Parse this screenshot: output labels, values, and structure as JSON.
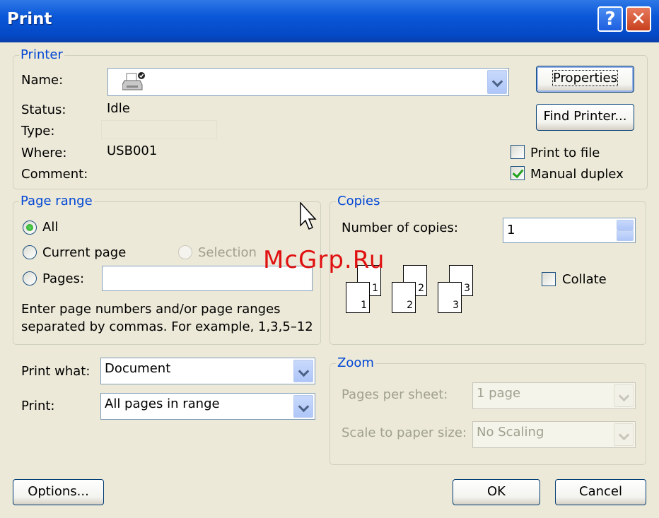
{
  "window": {
    "title": "Print",
    "help_label": "?",
    "close_label": "✕"
  },
  "printer": {
    "legend": "Printer",
    "name_label": "Name:",
    "name_value": "",
    "status_label": "Status:",
    "status_value": "Idle",
    "type_label": "Type:",
    "type_value": "",
    "where_label": "Where:",
    "where_value": "USB001",
    "comment_label": "Comment:",
    "comment_value": "",
    "properties_label": "Properties",
    "find_printer_label": "Find Printer...",
    "print_to_file_label": "Print to file",
    "print_to_file_checked": false,
    "manual_duplex_label": "Manual duplex",
    "manual_duplex_checked": true
  },
  "page_range": {
    "legend": "Page range",
    "all_label": "All",
    "current_page_label": "Current page",
    "selection_label": "Selection",
    "pages_label": "Pages:",
    "pages_value": "",
    "hint_line1": "Enter page numbers and/or page ranges",
    "hint_line2": "separated by commas.  For example, 1,3,5–12",
    "selected": "all"
  },
  "copies": {
    "legend": "Copies",
    "number_label": "Number of copies:",
    "number_value": "1",
    "collate_label": "Collate",
    "collate_checked": false,
    "page_numbers": [
      "1",
      "1",
      "2",
      "2",
      "3",
      "3"
    ]
  },
  "print_what": {
    "label": "Print what:",
    "value": "Document"
  },
  "print": {
    "label": "Print:",
    "value": "All pages in range"
  },
  "zoom": {
    "legend": "Zoom",
    "pages_per_sheet_label": "Pages per sheet:",
    "pages_per_sheet_value": "1 page",
    "scale_label": "Scale to paper size:",
    "scale_value": "No Scaling"
  },
  "buttons": {
    "options": "Options...",
    "ok": "OK",
    "cancel": "Cancel"
  },
  "watermark": "McGrp.Ru",
  "colors": {
    "title_bar": "#0a57d8",
    "legend": "#0046d5",
    "dialog_bg": "#ece9d8",
    "watermark": "#e01010"
  }
}
